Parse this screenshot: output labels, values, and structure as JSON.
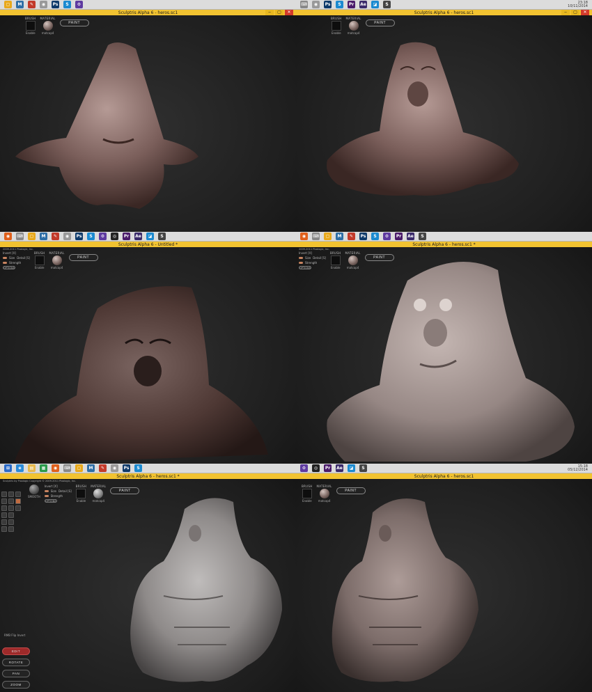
{
  "colors": {
    "titlebar": "#f2c331",
    "taskbar": "#dcdcdc",
    "viewport": "#262626",
    "clay_brown": "#7a5e5a",
    "clay_grey": "#9a8c88",
    "accent_red": "#9e2a2a"
  },
  "taskbar_icons": [
    "folder-icon",
    "maya-icon",
    "pencil-icon",
    "game-icon",
    "photoshop-icon",
    "sculptris-icon",
    "gear-icon",
    "camera-icon",
    "premiere-icon",
    "after-effects-icon",
    "blue-app-icon",
    "sculptris-app-icon"
  ],
  "panels": [
    {
      "title": "Sculptris Alpha 6 - heros.sc1",
      "toolbar": {
        "brush_label": "BRUSH",
        "material_label": "MATERIAL",
        "paint_label": "PAINT",
        "enable_label": "Enable",
        "matcap_label": "matcap4"
      },
      "clock": {
        "time": "23:18",
        "date": "10/11/2014"
      }
    },
    {
      "title": "Sculptris Alpha 6 - heros.sc1",
      "toolbar": {
        "brush_label": "BRUSH",
        "material_label": "MATERIAL",
        "paint_label": "PAINT",
        "enable_label": "Enable",
        "matcap_label": "matcap4"
      }
    },
    {
      "title": "Sculptris Alpha 6 - Untitled *",
      "toolbar": {
        "brush_label": "BRUSH",
        "material_label": "MATERIAL",
        "paint_label": "PAINT",
        "enable_label": "Enable",
        "matcap_label": "matcap4",
        "invert_label": "Invert [X]",
        "size_label": "Size",
        "strength_label": "Strength",
        "detail_label": "Detail [S]",
        "options_label": "OPTIONS"
      },
      "copyright": "2009-2011 Pixologic, Inc."
    },
    {
      "title": "Sculptris Alpha 6 - heros.sc1 *",
      "toolbar": {
        "brush_label": "BRUSH",
        "material_label": "MATERIAL",
        "paint_label": "PAINT",
        "enable_label": "Enable",
        "matcap_label": "matcap4",
        "invert_label": "Invert [X]",
        "size_label": "Size",
        "strength_label": "Strength",
        "detail_label": "Detail [S]",
        "options_label": "OPTIONS"
      },
      "copyright": "2009-2011 Pixologic, Inc."
    },
    {
      "title": "Sculptris Alpha 6 - heros.sc1 *",
      "toolbar": {
        "brush_label": "BRUSH",
        "material_label": "MATERIAL",
        "paint_label": "PAINT",
        "enable_label": "Enable",
        "matcap_label": "matcap4",
        "invert_label": "Invert [X]",
        "size_label": "Size",
        "strength_label": "Strength",
        "detail_label": "Detail [S]",
        "options_label": "OPTIONS",
        "smooth_label": "SMOOTH"
      },
      "copyright": "Sculptris by Pixologic   Copyright © 2009-2011 Pixologic, Inc.",
      "clock": {
        "time": "15:18",
        "date": "05/12/2014"
      },
      "modes": [
        "EDIT",
        "ROTATE",
        "PAN",
        "ZOOM"
      ],
      "hint": "RMB  Flip Invert"
    },
    {
      "title": "Sculptris Alpha 6 - heros.sc1",
      "toolbar": {
        "brush_label": "BRUSH",
        "material_label": "MATERIAL",
        "paint_label": "PAINT",
        "enable_label": "Enable",
        "matcap_label": "matcap4"
      }
    }
  ]
}
